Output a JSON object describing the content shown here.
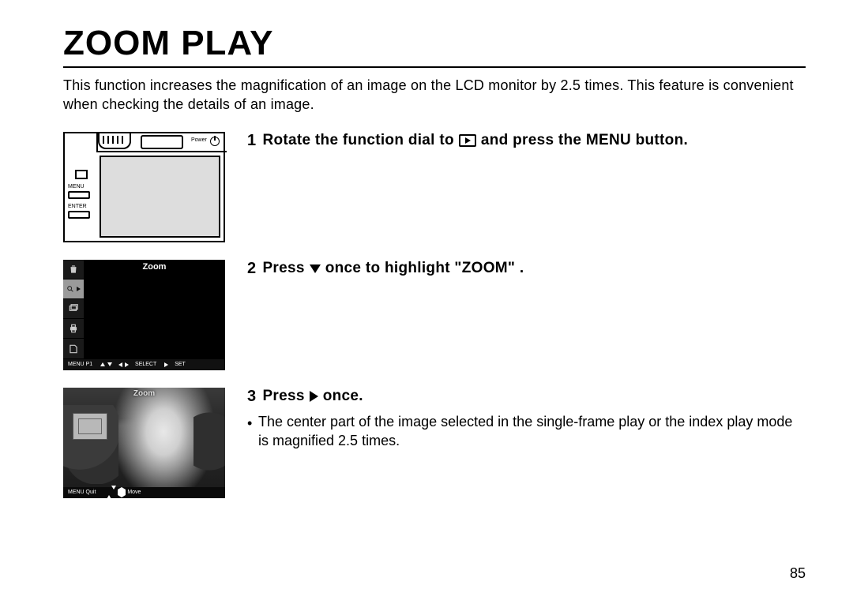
{
  "title": "ZOOM PLAY",
  "intro": "This function increases the magnification of an image on the LCD monitor by 2.5 times. This feature is convenient when checking the details of an image.",
  "steps": {
    "s1": {
      "num": "1",
      "pre": "Rotate the function dial to",
      "post": "and press the MENU button."
    },
    "s2": {
      "num": "2",
      "pre": "Press",
      "post": "once to highlight \"ZOOM\" ."
    },
    "s3": {
      "num": "3",
      "pre": "Press",
      "post": "once."
    }
  },
  "note": "The center part of the image selected in the single-frame play or the index play mode is magnified 2.5 times.",
  "bullet": "•",
  "fig1": {
    "power": "Power",
    "menu": "MENU",
    "enter": "ENTER"
  },
  "fig2": {
    "title": "Zoom",
    "bar": {
      "menu": "MENU P1",
      "select": "SELECT",
      "set": "SET"
    }
  },
  "fig3": {
    "title": "Zoom",
    "bar": {
      "menu": "MENU Quit",
      "move": "Move"
    }
  },
  "pageNumber": "85"
}
